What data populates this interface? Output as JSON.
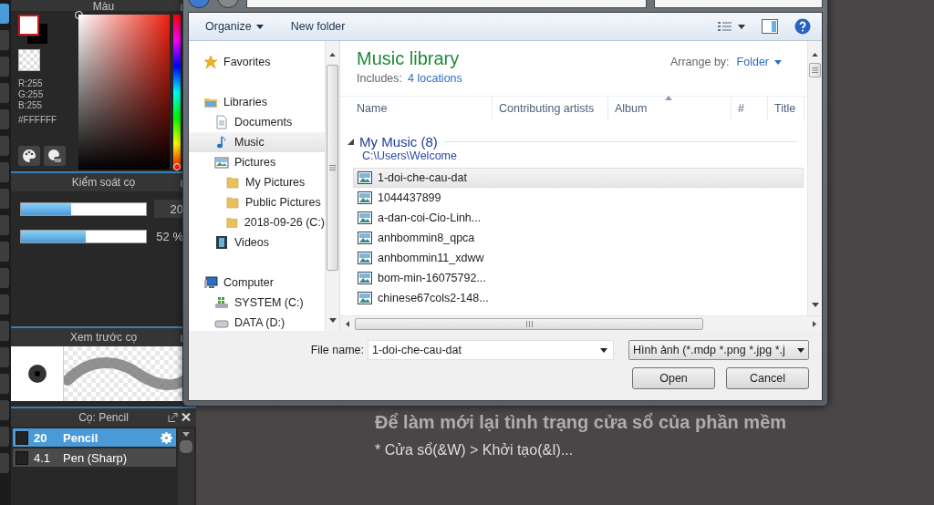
{
  "paint_app": {
    "tools": [
      {
        "selected": true
      },
      {
        "selected": false
      },
      {
        "selected": false
      },
      {
        "selected": false
      },
      {
        "selected": false
      },
      {
        "selected": false
      },
      {
        "selected": false
      },
      {
        "selected": false
      },
      {
        "selected": false
      },
      {
        "selected": false
      },
      {
        "selected": false
      },
      {
        "selected": false
      },
      {
        "selected": false
      },
      {
        "selected": false
      },
      {
        "selected": false
      },
      {
        "selected": false
      },
      {
        "selected": false
      },
      {
        "selected": false
      }
    ],
    "color_panel": {
      "title": "Màu",
      "hue": {
        "level": 0
      },
      "rgb": [
        "R:255",
        "G:255",
        "B:255"
      ],
      "hex": "#FFFFFF"
    },
    "brush_control": {
      "title": "Kiểm soát cọ",
      "sliders": [
        {
          "kind": "boxed",
          "level": 0.4,
          "reading": "20"
        },
        {
          "kind": "plain",
          "level": 0.52,
          "reading": "52 %"
        }
      ]
    },
    "brush_preview": {
      "title": "Xem trước cọ"
    },
    "brush_list": {
      "title": "Cọ: Pencil",
      "items": [
        {
          "size": "20",
          "name": "Pencil",
          "selected": true
        },
        {
          "size": "4.1",
          "name": "Pen (Sharp)",
          "selected": false
        }
      ]
    },
    "canvas_text": [
      "Để làm mới lại tình trạng cửa sổ của phần mềm",
      "* Cửa sổ(&W) > Khởi tạo(&I)..."
    ]
  },
  "open_dialog": {
    "toolbar": {
      "organize": "Organize",
      "new_folder": "New folder"
    },
    "nav": [
      {
        "label": "Favorites",
        "kind": "star",
        "selected": false
      },
      {
        "label": "Libraries",
        "kind": "library",
        "selected": false,
        "children": [
          {
            "label": "Documents",
            "kind": "document",
            "selected": false
          },
          {
            "label": "Music",
            "kind": "music",
            "selected": true
          },
          {
            "label": "Pictures",
            "kind": "pictures",
            "selected": false,
            "children": [
              {
                "label": "My Pictures",
                "kind": "folder",
                "selected": false
              },
              {
                "label": "Public Pictures",
                "kind": "folder",
                "selected": false
              },
              {
                "label": "2018-09-26 (C:)",
                "kind": "folder",
                "selected": false
              }
            ]
          },
          {
            "label": "Videos",
            "kind": "videos",
            "selected": false
          }
        ]
      },
      {
        "label": "Computer",
        "kind": "computer",
        "selected": false,
        "children": [
          {
            "label": "SYSTEM (C:)",
            "kind": "system-drive",
            "selected": false
          },
          {
            "label": "DATA (D:)",
            "kind": "drive",
            "selected": false
          }
        ]
      }
    ],
    "library": {
      "title": "Music library",
      "includes_label": "Includes:",
      "includes_link": "4 locations",
      "arrange_label": "Arrange by:",
      "arrange_value": "Folder"
    },
    "columns": [
      "Name",
      "Contributing artists",
      "Album",
      "#",
      "Title"
    ],
    "group": {
      "title": "My Music (8)",
      "path": "C:\\Users\\Welcome",
      "expanded": true
    },
    "files": [
      {
        "name": "1-doi-che-cau-dat",
        "selected": true
      },
      {
        "name": "1044437899",
        "selected": false
      },
      {
        "name": "a-dan-coi-Cio-Linh...",
        "selected": false
      },
      {
        "name": "anhbommin8_qpca",
        "selected": false
      },
      {
        "name": "anhbommin11_xdww",
        "selected": false
      },
      {
        "name": "bom-min-16075792...",
        "selected": false
      },
      {
        "name": "chinese67cols2-148...",
        "selected": false
      }
    ],
    "file_name_label": "File name:",
    "file_name": "1-doi-che-cau-dat",
    "file_type": "Hình ảnh (*.mdp *.png *.jpg *.j",
    "buttons": [
      "Open",
      "Cancel"
    ]
  }
}
